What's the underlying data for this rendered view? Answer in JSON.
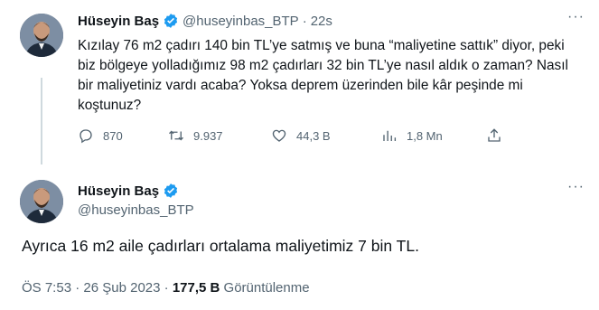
{
  "tweet1": {
    "name": "Hüseyin Baş",
    "handle": "@huseyinbas_BTP",
    "separator": "·",
    "time": "22s",
    "text": "Kızılay 76 m2 çadırı 140 bin TL’ye satmış ve buna “maliyetine sattık” diyor, peki biz bölgeye yolladığımız 98 m2 çadırları 32 bin TL’ye nasıl aldık o zaman? Nasıl bir maliyetiniz vardı acaba? Yoksa deprem üzerinden bile kâr peşinde mi koştunuz?",
    "actions": {
      "replies": "870",
      "retweets": "9.937",
      "likes": "44,3 B",
      "views": "1,8 Mn"
    }
  },
  "tweet2": {
    "name": "Hüseyin Baş",
    "handle": "@huseyinbas_BTP",
    "text": "Ayrıca 16 m2 aile çadırları ortalama maliyetimiz 7 bin TL.",
    "meta": {
      "time": "ÖS 7:53",
      "separator1": " · ",
      "date": "26 Şub 2023",
      "separator2": " · ",
      "views_count": "177,5 B",
      "views_label": " Görüntülenme"
    }
  },
  "icons": {
    "verified": "verified-badge-icon",
    "more": "more-options-icon",
    "reply": "reply-icon",
    "retweet": "retweet-icon",
    "like": "heart-icon",
    "views": "views-chart-icon",
    "share": "share-icon"
  },
  "colors": {
    "accent": "#1d9bf0",
    "text": "#0f1419",
    "secondary": "#536471",
    "thread_line": "#cfd9de"
  }
}
